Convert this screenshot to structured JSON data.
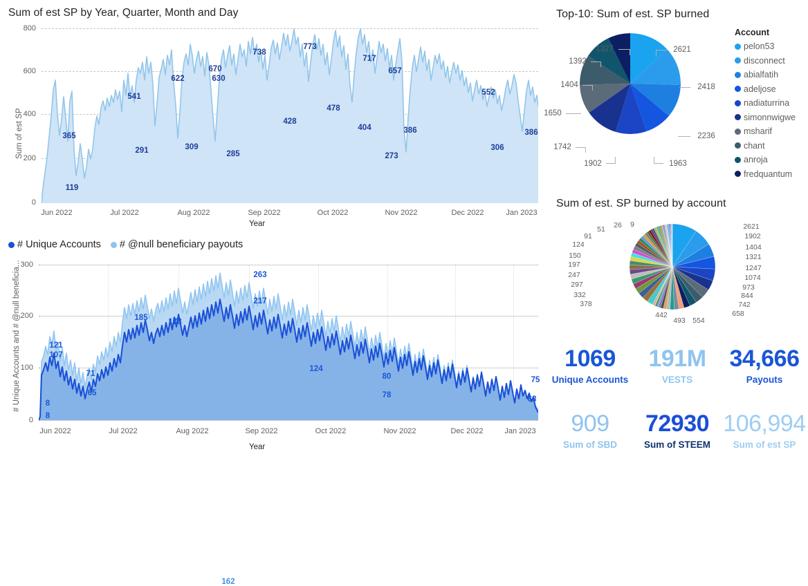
{
  "charts": {
    "area_sp": {
      "title": "Sum of est SP by Year, Quarter, Month and Day",
      "ylabel": "Sum of est SP",
      "xlabel": "Year",
      "yticks": [
        "0",
        "200",
        "400",
        "600",
        "800"
      ],
      "xticks": [
        "Jun 2022",
        "Jul 2022",
        "Aug 2022",
        "Sep 2022",
        "Oct 2022",
        "Nov 2022",
        "Dec 2022",
        "Jan 2023"
      ],
      "data_labels": [
        "119",
        "365",
        "541",
        "291",
        "622",
        "309",
        "670",
        "630",
        "285",
        "738",
        "428",
        "773",
        "478",
        "717",
        "404",
        "657",
        "273",
        "386",
        "552",
        "306",
        "386"
      ]
    },
    "accounts": {
      "ylabel": "# Unique Accounts and # @null beneficia...",
      "xlabel": "Year",
      "yticks": [
        "0",
        "100",
        "200",
        "300"
      ],
      "xticks": [
        "Jun 2022",
        "Jul 2022",
        "Aug 2022",
        "Sep 2022",
        "Oct 2022",
        "Nov 2022",
        "Dec 2022",
        "Jan 2023"
      ],
      "legend": [
        {
          "label": "# Unique Accounts",
          "color": "#1a4fd6"
        },
        {
          "label": "# @null beneficiary payouts",
          "color": "#8ec4f0"
        }
      ],
      "data_labels": [
        "8",
        "8",
        "121",
        "107",
        "71",
        "65",
        "185",
        "178",
        "162",
        "263",
        "217",
        "124",
        "80",
        "78",
        "75",
        "68"
      ]
    },
    "top10": {
      "title": "Top-10: Sum of est. SP burned",
      "legend_title": "Account",
      "slices": [
        {
          "label": "pelon53",
          "value": 2621,
          "color": "#1aa3ef"
        },
        {
          "label": "disconnect",
          "value": 2418,
          "color": "#2b9ceb"
        },
        {
          "label": "abialfatih",
          "value": 2236,
          "color": "#1f7fe0"
        },
        {
          "label": "adeljose",
          "value": 1963,
          "color": "#1456e0"
        },
        {
          "label": "nadiaturrina",
          "value": 1902,
          "color": "#1b45c4"
        },
        {
          "label": "simonnwigwe",
          "value": 1742,
          "color": "#19328f"
        },
        {
          "label": "msharif",
          "value": 1650,
          "color": "#5c6b7a"
        },
        {
          "label": "chant",
          "value": 1404,
          "color": "#3c5c6b"
        },
        {
          "label": "anroja",
          "value": 1392,
          "color": "#10556b"
        },
        {
          "label": "fredquantum",
          "value": 1327,
          "color": "#0d1f63"
        }
      ]
    },
    "by_account": {
      "title": "Sum of est. SP burned by account",
      "labels_right": [
        "2621",
        "1902",
        "1404",
        "1321",
        "1247",
        "1074",
        "973",
        "844",
        "742",
        "658"
      ],
      "labels_bottom": [
        "554",
        "493",
        "442"
      ],
      "labels_left": [
        "378",
        "332",
        "297",
        "247",
        "197",
        "150",
        "124",
        "91",
        "51"
      ],
      "labels_top": [
        "26",
        "9"
      ]
    }
  },
  "kpis": [
    {
      "value": "1069",
      "label": "Unique Accounts",
      "value_color": "#1a56d6",
      "label_color": "#1a56d6"
    },
    {
      "value": "191M",
      "label": "VESTS",
      "value_color": "#8ec4f0",
      "label_color": "#8ec4f0"
    },
    {
      "value": "34,666",
      "label": "Payouts",
      "value_color": "#1a56d6",
      "label_color": "#1a56d6"
    },
    {
      "value": "909",
      "label": "Sum of SBD",
      "value_color": "#8ec4f0",
      "label_color": "#8ec4f0"
    },
    {
      "value": "72930",
      "label": "Sum of STEEM",
      "value_color": "#1a4fd6",
      "label_color": "#10316e"
    },
    {
      "value": "106,994",
      "label": "Sum of est SP",
      "value_color": "#9ecdf2",
      "label_color": "#9ecdf2"
    }
  ]
}
